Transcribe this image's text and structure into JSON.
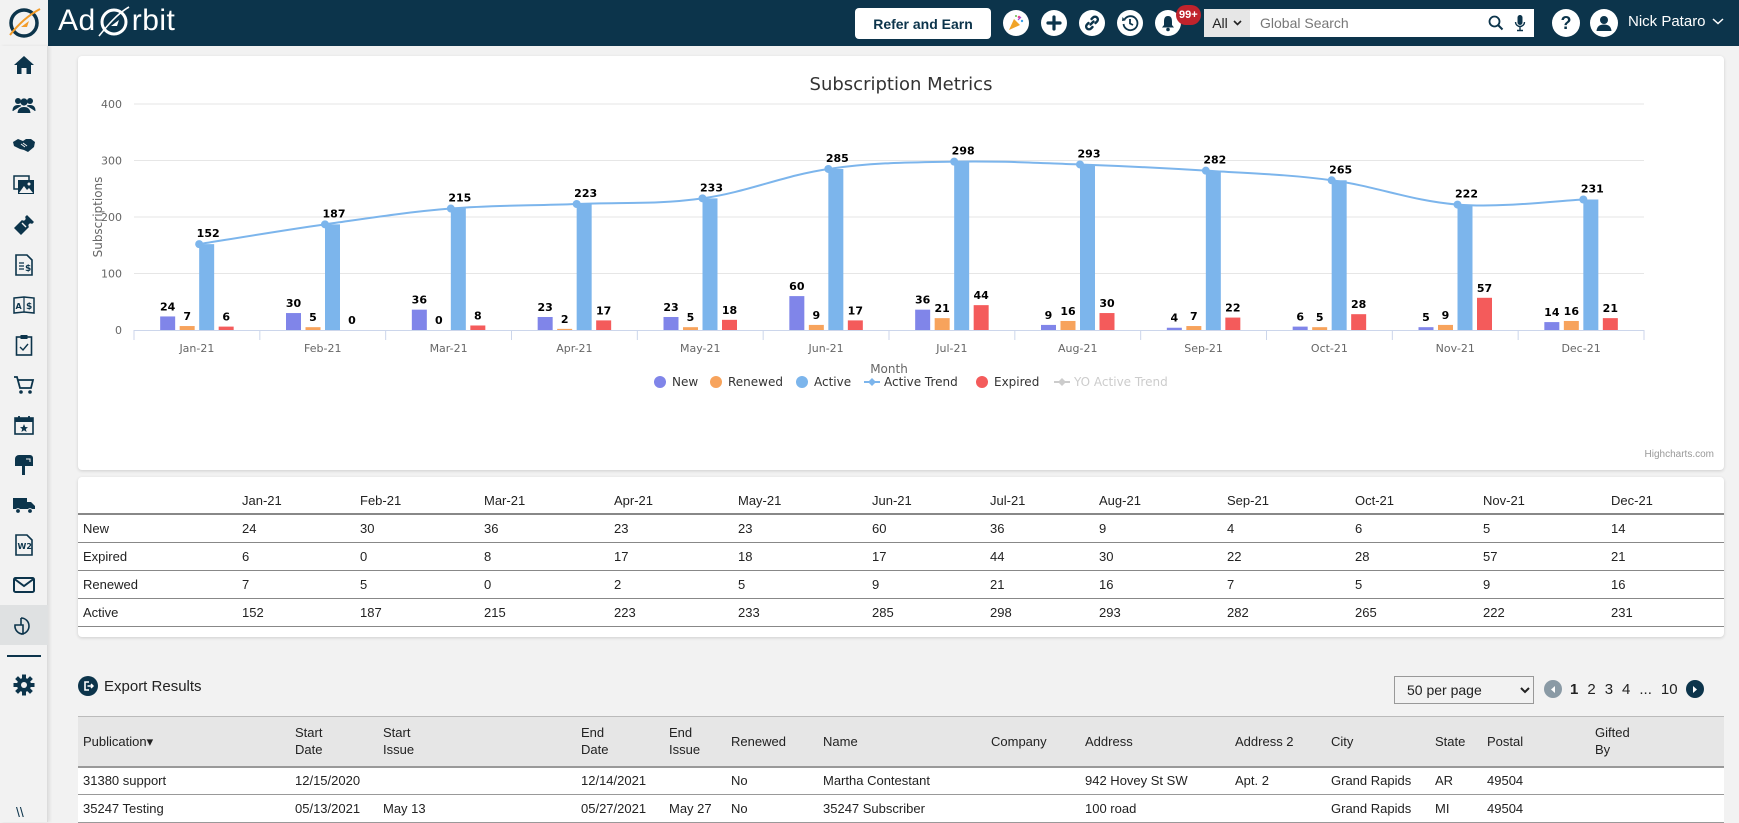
{
  "topbar": {
    "brand": "Ad Orbit",
    "refer_label": "Refer and Earn",
    "notification_badge": "99+",
    "search_scope": "All",
    "search_placeholder": "Global Search",
    "user_name": "Nick Pataro",
    "icons": [
      "celebration-icon",
      "plus-icon",
      "link-icon",
      "history-icon",
      "bell-icon",
      "search-icon",
      "microphone-icon",
      "help-icon",
      "user-avatar-icon"
    ]
  },
  "sidebar": {
    "items": [
      {
        "icon": "home-icon"
      },
      {
        "icon": "users-icon"
      },
      {
        "icon": "handshake-icon"
      },
      {
        "icon": "images-icon"
      },
      {
        "icon": "ticket-icon"
      },
      {
        "icon": "invoice-icon"
      },
      {
        "icon": "currency-exchange-icon"
      },
      {
        "icon": "clipboard-check-icon"
      },
      {
        "icon": "cart-icon"
      },
      {
        "icon": "calendar-star-icon"
      },
      {
        "icon": "mailbox-icon"
      },
      {
        "icon": "truck-icon"
      },
      {
        "icon": "w2-document-icon"
      },
      {
        "icon": "envelope-icon"
      },
      {
        "icon": "reports-chart-icon",
        "active": true
      },
      {
        "icon": "gear-icon"
      }
    ],
    "collapse_label": "\\\\"
  },
  "colors": {
    "new": "#8085e9",
    "renewed": "#f7a35c",
    "active": "#7cb5ec",
    "expired": "#f45b5b",
    "trend": "#7cb5ec",
    "yo_trend_hidden": "#cccccc",
    "nav": "#0c344b"
  },
  "chart_data": {
    "type": "bar",
    "title": "Subscription Metrics",
    "xlabel": "Month",
    "ylabel": "Subscriptions",
    "ylim": [
      0,
      400
    ],
    "yticks": [
      0,
      100,
      200,
      300,
      400
    ],
    "grid": true,
    "legend_position": "bottom-center",
    "credit": "Highcharts.com",
    "categories": [
      "Jan-21",
      "Feb-21",
      "Mar-21",
      "Apr-21",
      "May-21",
      "Jun-21",
      "Jul-21",
      "Aug-21",
      "Sep-21",
      "Oct-21",
      "Nov-21",
      "Dec-21"
    ],
    "series": [
      {
        "name": "New",
        "type": "bar",
        "values": [
          24,
          30,
          36,
          23,
          23,
          60,
          36,
          9,
          4,
          6,
          5,
          14
        ]
      },
      {
        "name": "Renewed",
        "type": "bar",
        "values": [
          7,
          5,
          0,
          2,
          5,
          9,
          21,
          16,
          7,
          5,
          9,
          16
        ]
      },
      {
        "name": "Active",
        "type": "bar",
        "values": [
          152,
          187,
          215,
          223,
          233,
          285,
          298,
          293,
          282,
          265,
          222,
          231
        ]
      },
      {
        "name": "Active Trend",
        "type": "line",
        "values": [
          152,
          187,
          215,
          223,
          233,
          285,
          298,
          293,
          282,
          265,
          222,
          231
        ]
      },
      {
        "name": "Expired",
        "type": "bar",
        "values": [
          6,
          0,
          8,
          17,
          18,
          17,
          44,
          30,
          22,
          28,
          57,
          21
        ]
      },
      {
        "name": "YO Active Trend",
        "type": "line",
        "hidden": true,
        "values": []
      }
    ]
  },
  "metric_table": {
    "headers": [
      "",
      "Jan-21",
      "Feb-21",
      "Mar-21",
      "Apr-21",
      "May-21",
      "Jun-21",
      "Jul-21",
      "Aug-21",
      "Sep-21",
      "Oct-21",
      "Nov-21",
      "Dec-21"
    ],
    "rows": [
      [
        "New",
        "24",
        "30",
        "36",
        "23",
        "23",
        "60",
        "36",
        "9",
        "4",
        "6",
        "5",
        "14"
      ],
      [
        "Expired",
        "6",
        "0",
        "8",
        "17",
        "18",
        "17",
        "44",
        "30",
        "22",
        "28",
        "57",
        "21"
      ],
      [
        "Renewed",
        "7",
        "5",
        "0",
        "2",
        "5",
        "9",
        "21",
        "16",
        "7",
        "5",
        "9",
        "16"
      ],
      [
        "Active",
        "152",
        "187",
        "215",
        "223",
        "233",
        "285",
        "298",
        "293",
        "282",
        "265",
        "222",
        "231"
      ]
    ]
  },
  "export": {
    "label": "Export Results"
  },
  "pagination": {
    "per_page": "50 per page",
    "per_page_options": [
      "50 per page"
    ],
    "pages": [
      "1",
      "2",
      "3",
      "4",
      "...",
      "10"
    ],
    "current": "1"
  },
  "results": {
    "headers": [
      "Publication▾",
      "Start Date",
      "Start Issue",
      "End Date",
      "End Issue",
      "Renewed",
      "Name",
      "Company",
      "Address",
      "Address 2",
      "City",
      "State",
      "Postal",
      "Gifted By"
    ],
    "rows": [
      [
        "31380 support",
        "12/15/2020",
        "",
        "12/14/2021",
        "",
        "No",
        "Martha Contestant",
        "",
        "942 Hovey St SW",
        "Apt. 2",
        "Grand Rapids",
        "AR",
        "49504",
        ""
      ],
      [
        "35247 Testing",
        "05/13/2021",
        "May 13",
        "05/27/2021",
        "May 27",
        "No",
        "35247 Subscriber",
        "",
        "100 road",
        "",
        "Grand Rapids",
        "MI",
        "49504",
        ""
      ]
    ]
  }
}
